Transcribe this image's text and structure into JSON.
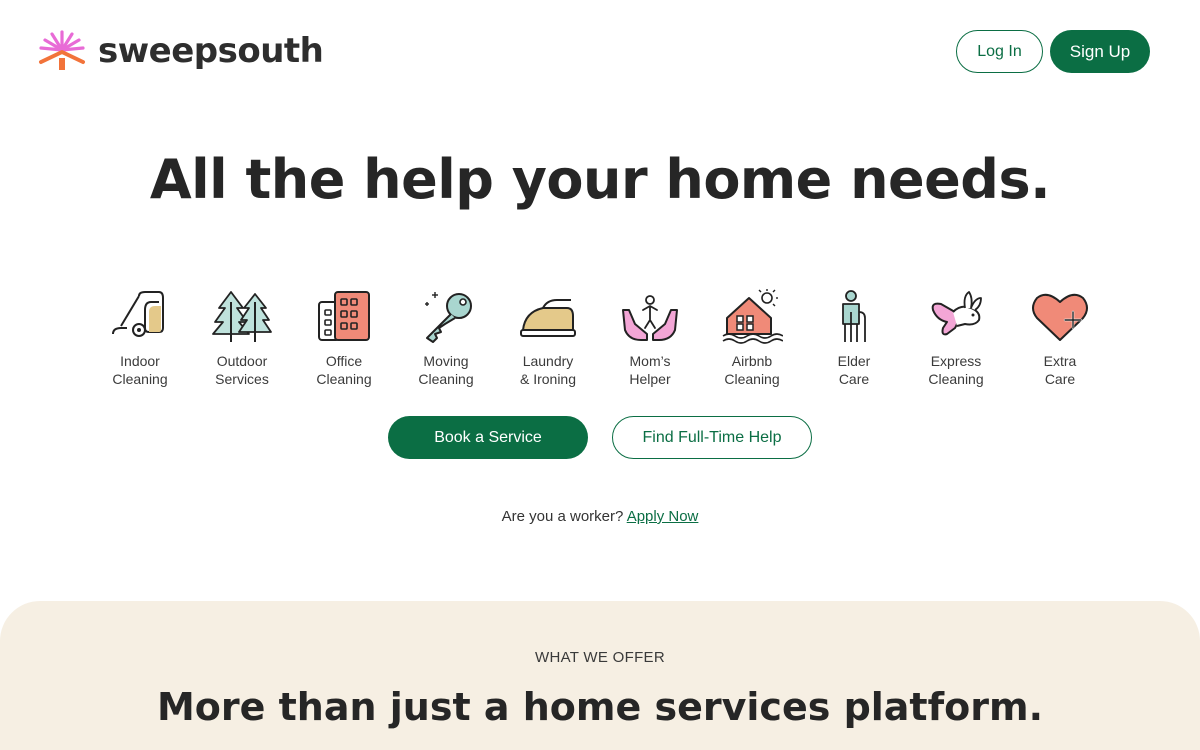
{
  "header": {
    "logo_text": "sweepsouth",
    "login_label": "Log In",
    "signup_label": "Sign Up"
  },
  "hero": {
    "title": "All the help your home needs."
  },
  "services": [
    {
      "line1": "Indoor",
      "line2": "Cleaning",
      "icon": "vacuum-icon"
    },
    {
      "line1": "Outdoor",
      "line2": "Services",
      "icon": "trees-icon"
    },
    {
      "line1": "Office",
      "line2": "Cleaning",
      "icon": "office-building-icon"
    },
    {
      "line1": "Moving",
      "line2": "Cleaning",
      "icon": "key-icon"
    },
    {
      "line1": "Laundry",
      "line2": "& Ironing",
      "icon": "iron-icon"
    },
    {
      "line1": "Mom’s",
      "line2": "Helper",
      "icon": "hands-baby-icon"
    },
    {
      "line1": "Airbnb",
      "line2": "Cleaning",
      "icon": "house-sun-icon"
    },
    {
      "line1": "Elder",
      "line2": "Care",
      "icon": "elder-person-icon"
    },
    {
      "line1": "Express",
      "line2": "Cleaning",
      "icon": "rabbit-icon"
    },
    {
      "line1": "Extra",
      "line2": "Care",
      "icon": "heart-plus-icon"
    }
  ],
  "cta": {
    "book_label": "Book a Service",
    "find_label": "Find Full-Time Help"
  },
  "worker": {
    "question": "Are you a worker?",
    "link_label": "Apply Now"
  },
  "offer": {
    "kicker": "WHAT WE OFFER",
    "title": "More than just a home services platform."
  },
  "colors": {
    "brand_green": "#0b6e44",
    "offer_background": "#f6efe3",
    "logo_pink": "#e86bd6",
    "logo_orange": "#f2733a"
  }
}
